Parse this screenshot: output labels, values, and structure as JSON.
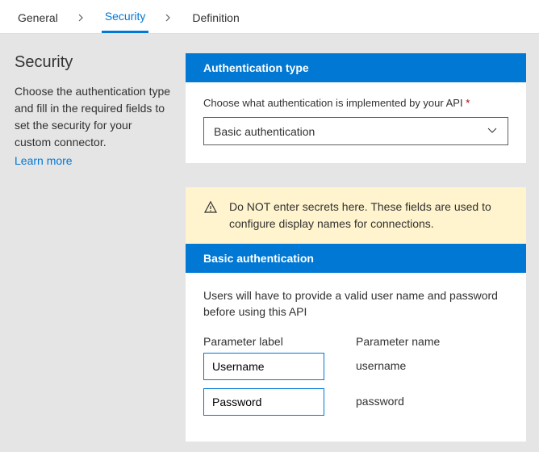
{
  "tabs": {
    "general": "General",
    "security": "Security",
    "definition": "Definition"
  },
  "sidebar": {
    "title": "Security",
    "description": "Choose the authentication type and fill in the required fields to set the security for your custom connector.",
    "learn_more": "Learn more"
  },
  "auth_type": {
    "header": "Authentication type",
    "label": "Choose what authentication is implemented by your API",
    "required": "*",
    "selected": "Basic authentication"
  },
  "warning": "Do NOT enter secrets here. These fields are used to configure display names for connections.",
  "basic_auth": {
    "header": "Basic authentication",
    "description": "Users will have to provide a valid user name and password before using this API",
    "col_label": "Parameter label",
    "col_name": "Parameter name",
    "params": [
      {
        "label": "Username",
        "name": "username"
      },
      {
        "label": "Password",
        "name": "password"
      }
    ]
  }
}
